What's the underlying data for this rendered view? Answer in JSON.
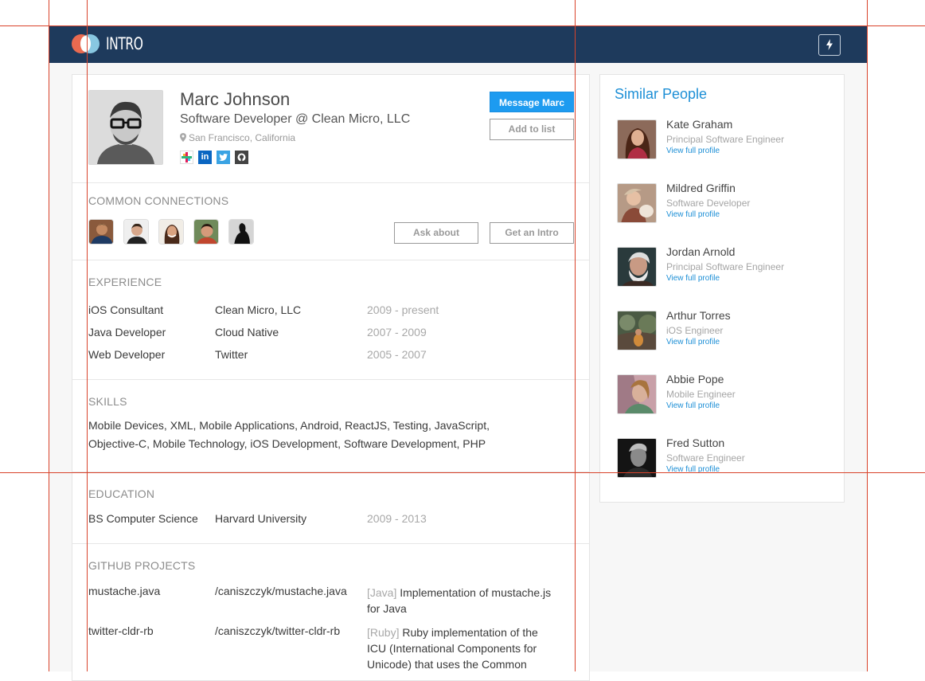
{
  "header": {
    "brand": "INTRO",
    "action_icon": "lightning-bolt-icon"
  },
  "profile": {
    "name": "Marc Johnson",
    "title": "Software Developer @ Clean Micro, LLC",
    "location": "San Francisco, California",
    "location_icon": "map-pin-icon",
    "social": [
      {
        "name": "slack-icon",
        "glyph": "✱",
        "color": "#ffffff"
      },
      {
        "name": "linkedin-icon",
        "glyph": "in",
        "color": "#0a66c2"
      },
      {
        "name": "twitter-icon",
        "glyph": "t",
        "color": "#3aa3e3"
      },
      {
        "name": "github-icon",
        "glyph": "●",
        "color": "#444444"
      }
    ],
    "message_btn": "Message Marc",
    "add_list_btn": "Add to list"
  },
  "connections": {
    "label": "COMMON CONNECTIONS",
    "ask_btn": "Ask about",
    "intro_btn": "Get an Intro"
  },
  "experience": {
    "label": "EXPERIENCE",
    "rows": [
      {
        "role": "iOS Consultant",
        "company": "Clean Micro, LLC",
        "years": "2009 - present"
      },
      {
        "role": "Java Developer",
        "company": "Cloud Native",
        "years": "2007 - 2009"
      },
      {
        "role": "Web Developer",
        "company": "Twitter",
        "years": "2005 - 2007"
      }
    ]
  },
  "skills": {
    "label": "SKILLS",
    "line1": "Mobile Devices, XML, Mobile Applications, Android, ReactJS, Testing, JavaScript,",
    "line2": "Objective-C, Mobile Technology, iOS Development, Software Development, PHP"
  },
  "education": {
    "label": "EDUCATION",
    "degree": "BS Computer Science",
    "school": "Harvard University",
    "years": "2009 - 2013"
  },
  "github": {
    "label": "GITHUB PROJECTS",
    "projects": [
      {
        "name": "mustache.java",
        "path": "/caniszczyk/mustache.java",
        "lang": "[Java]",
        "desc1": " Implementation of mustache.js",
        "desc2": "for Java",
        "desc3": ""
      },
      {
        "name": "twitter-cldr-rb",
        "path": "/caniszczyk/twitter-cldr-rb",
        "lang": "[Ruby]",
        "desc1": " Ruby implementation of the",
        "desc2": "ICU (International Components for",
        "desc3": "Unicode) that uses the Common"
      }
    ]
  },
  "similar": {
    "title": "Similar People",
    "link_label": "View full profile",
    "people": [
      {
        "name": "Kate Graham",
        "role": "Principal Software Engineer"
      },
      {
        "name": "Mildred Griffin",
        "role": "Software Developer"
      },
      {
        "name": "Jordan Arnold",
        "role": "Principal Software Engineer"
      },
      {
        "name": "Arthur Torres",
        "role": "iOS Engineer"
      },
      {
        "name": "Abbie Pope",
        "role": "Mobile Engineer"
      },
      {
        "name": "Fred Sutton",
        "role": "Software Engineer"
      }
    ]
  }
}
